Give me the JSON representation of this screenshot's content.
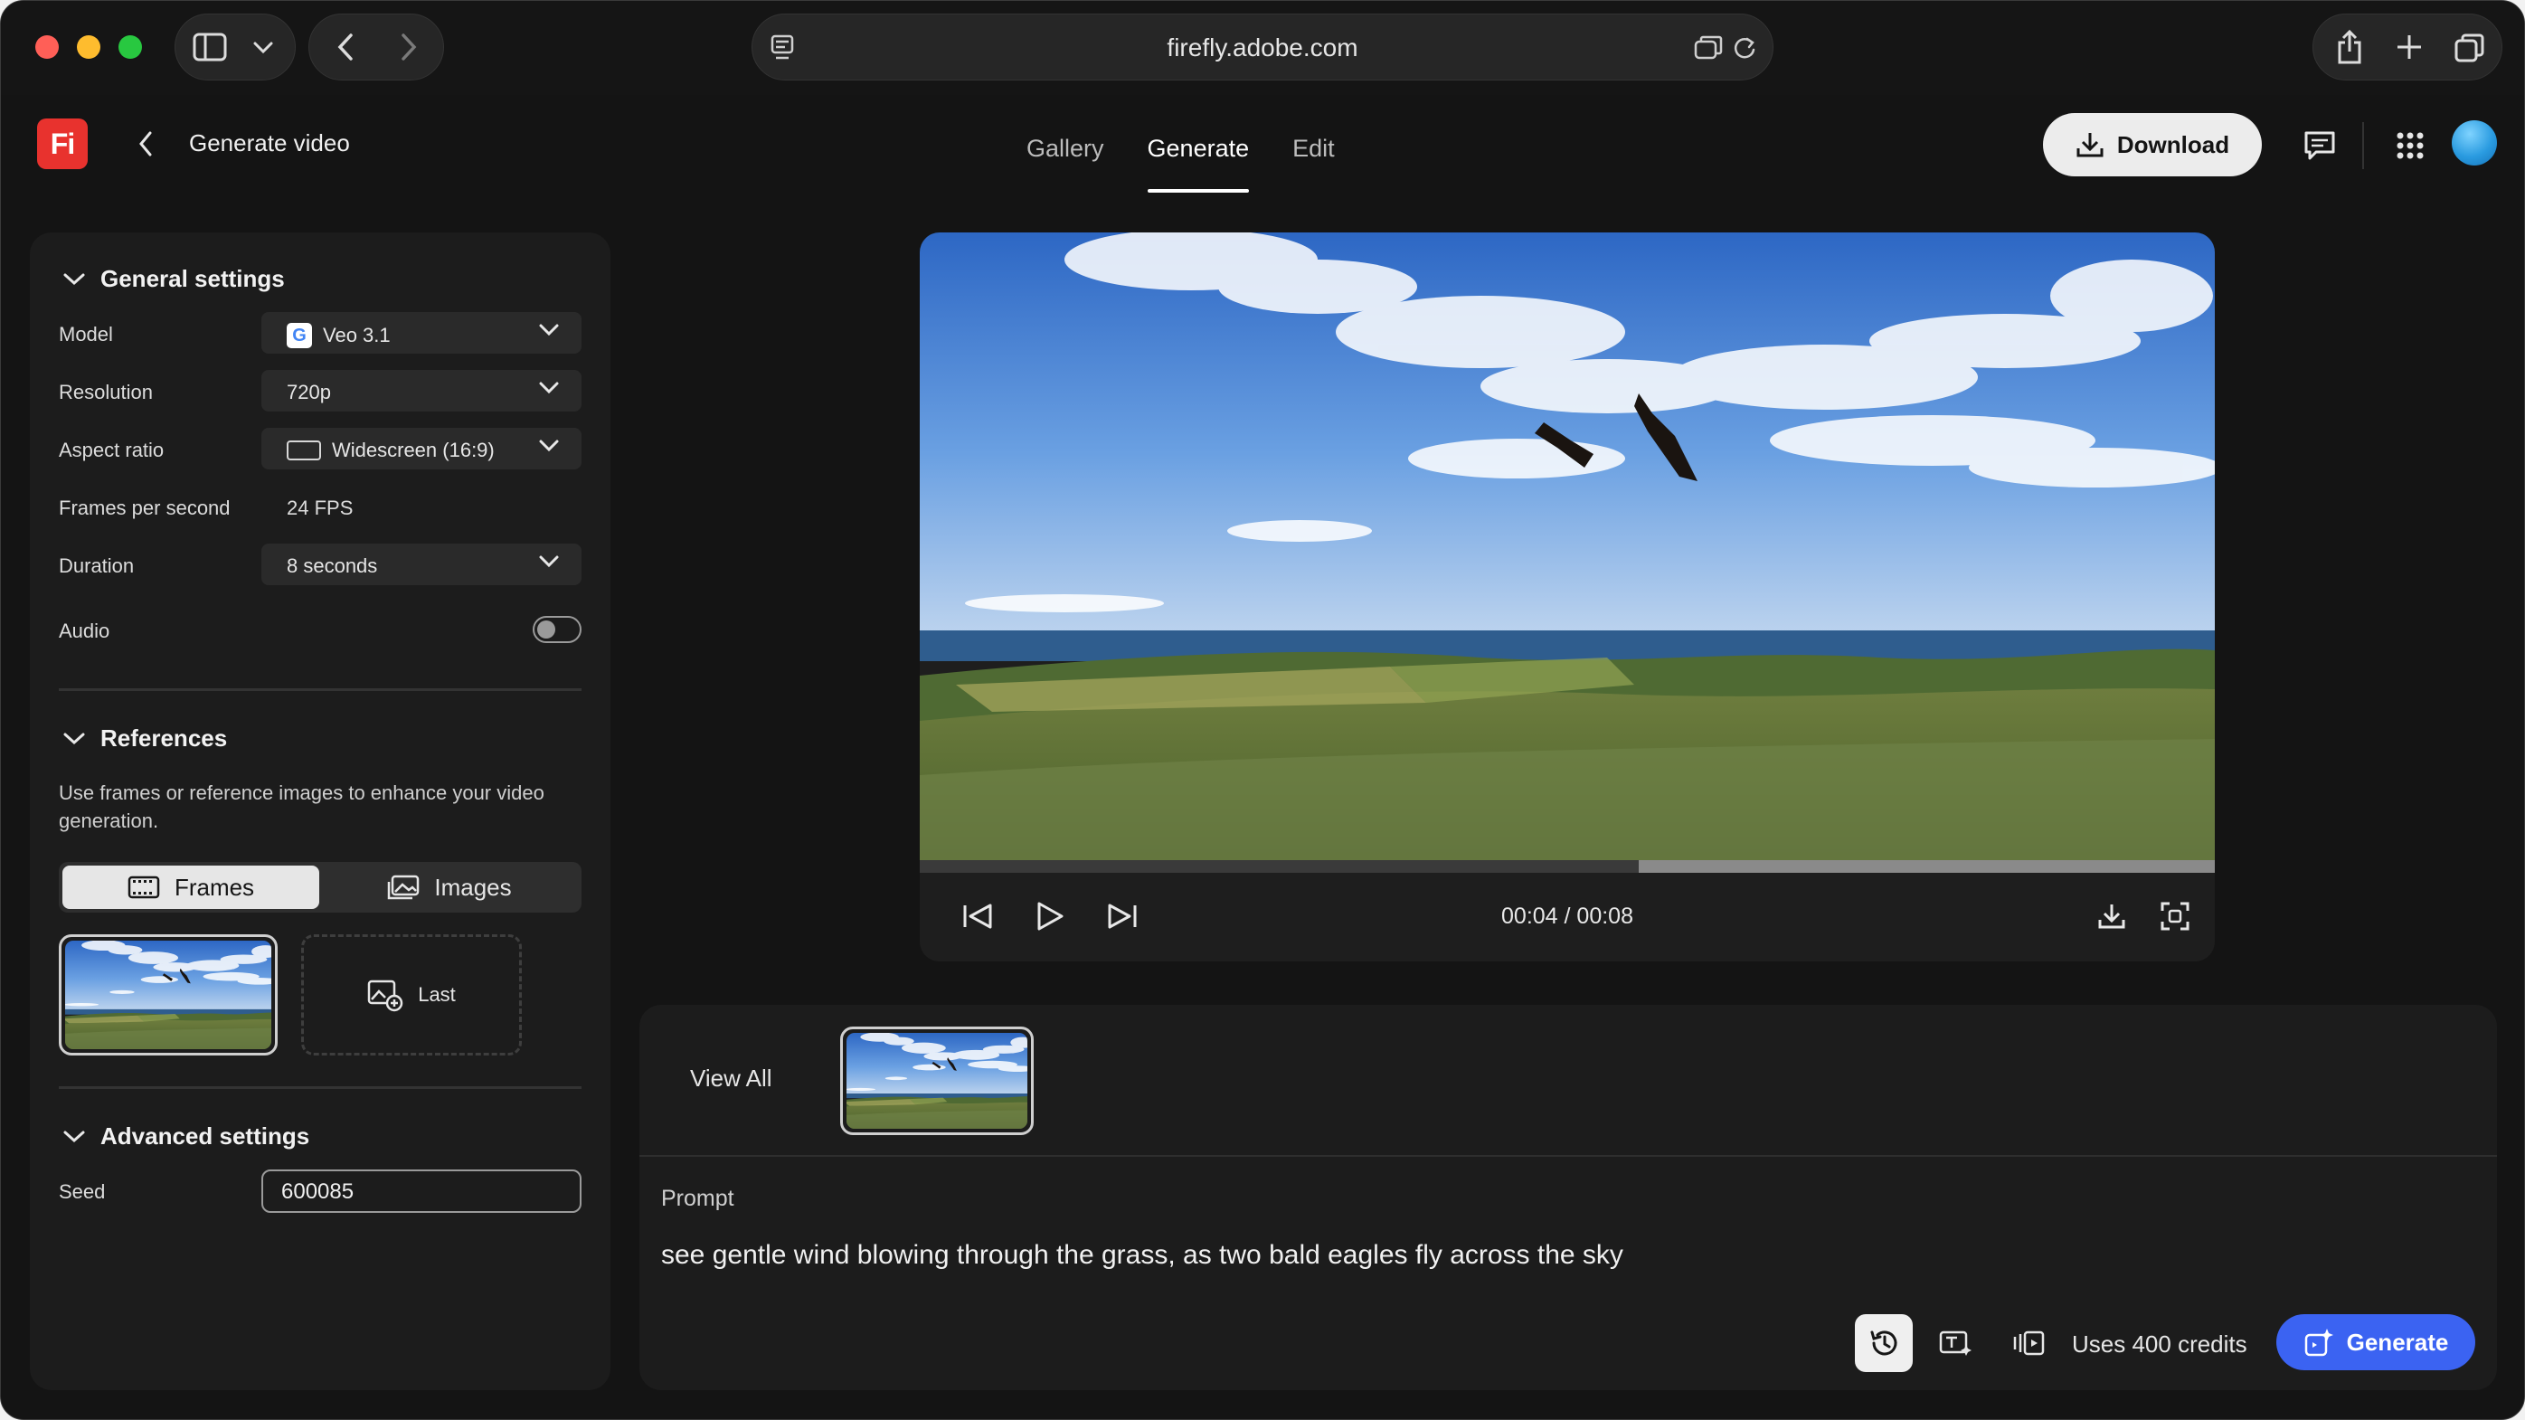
{
  "browser": {
    "url": "firefly.adobe.com"
  },
  "app": {
    "logo_text": "Fi",
    "page_title": "Generate video",
    "tabs": [
      {
        "label": "Gallery",
        "active": false
      },
      {
        "label": "Generate",
        "active": true
      },
      {
        "label": "Edit",
        "active": false
      }
    ],
    "download_label": "Download",
    "icons": [
      "comment-icon",
      "apps-grid-icon",
      "avatar"
    ]
  },
  "settings": {
    "general": {
      "title": "General settings",
      "model_label": "Model",
      "model_value": "Veo 3.1",
      "model_icon": "G",
      "resolution_label": "Resolution",
      "resolution_value": "720p",
      "aspect_label": "Aspect ratio",
      "aspect_value": "Widescreen (16:9)",
      "fps_label": "Frames per second",
      "fps_value": "24 FPS",
      "duration_label": "Duration",
      "duration_value": "8 seconds",
      "audio_label": "Audio",
      "audio_on": false
    },
    "references": {
      "title": "References",
      "description": "Use frames or reference images to enhance your video generation.",
      "frames_label": "Frames",
      "images_label": "Images",
      "active_mode": "Frames",
      "last_label": "Last"
    },
    "advanced": {
      "title": "Advanced settings",
      "seed_label": "Seed",
      "seed_value": "600085"
    }
  },
  "player": {
    "timecode": "00:04 / 00:08",
    "progress": 0.555
  },
  "prompt": {
    "view_all": "View All",
    "label": "Prompt",
    "text": "see gentle wind blowing through the grass, as two bald eagles fly across the sky",
    "credits": "Uses 400 credits",
    "generate_label": "Generate"
  },
  "colors": {
    "accent": "#3b63f2",
    "logo_red": "#e8322e",
    "panel_bg": "#1c1c1c",
    "app_bg": "#141414"
  }
}
